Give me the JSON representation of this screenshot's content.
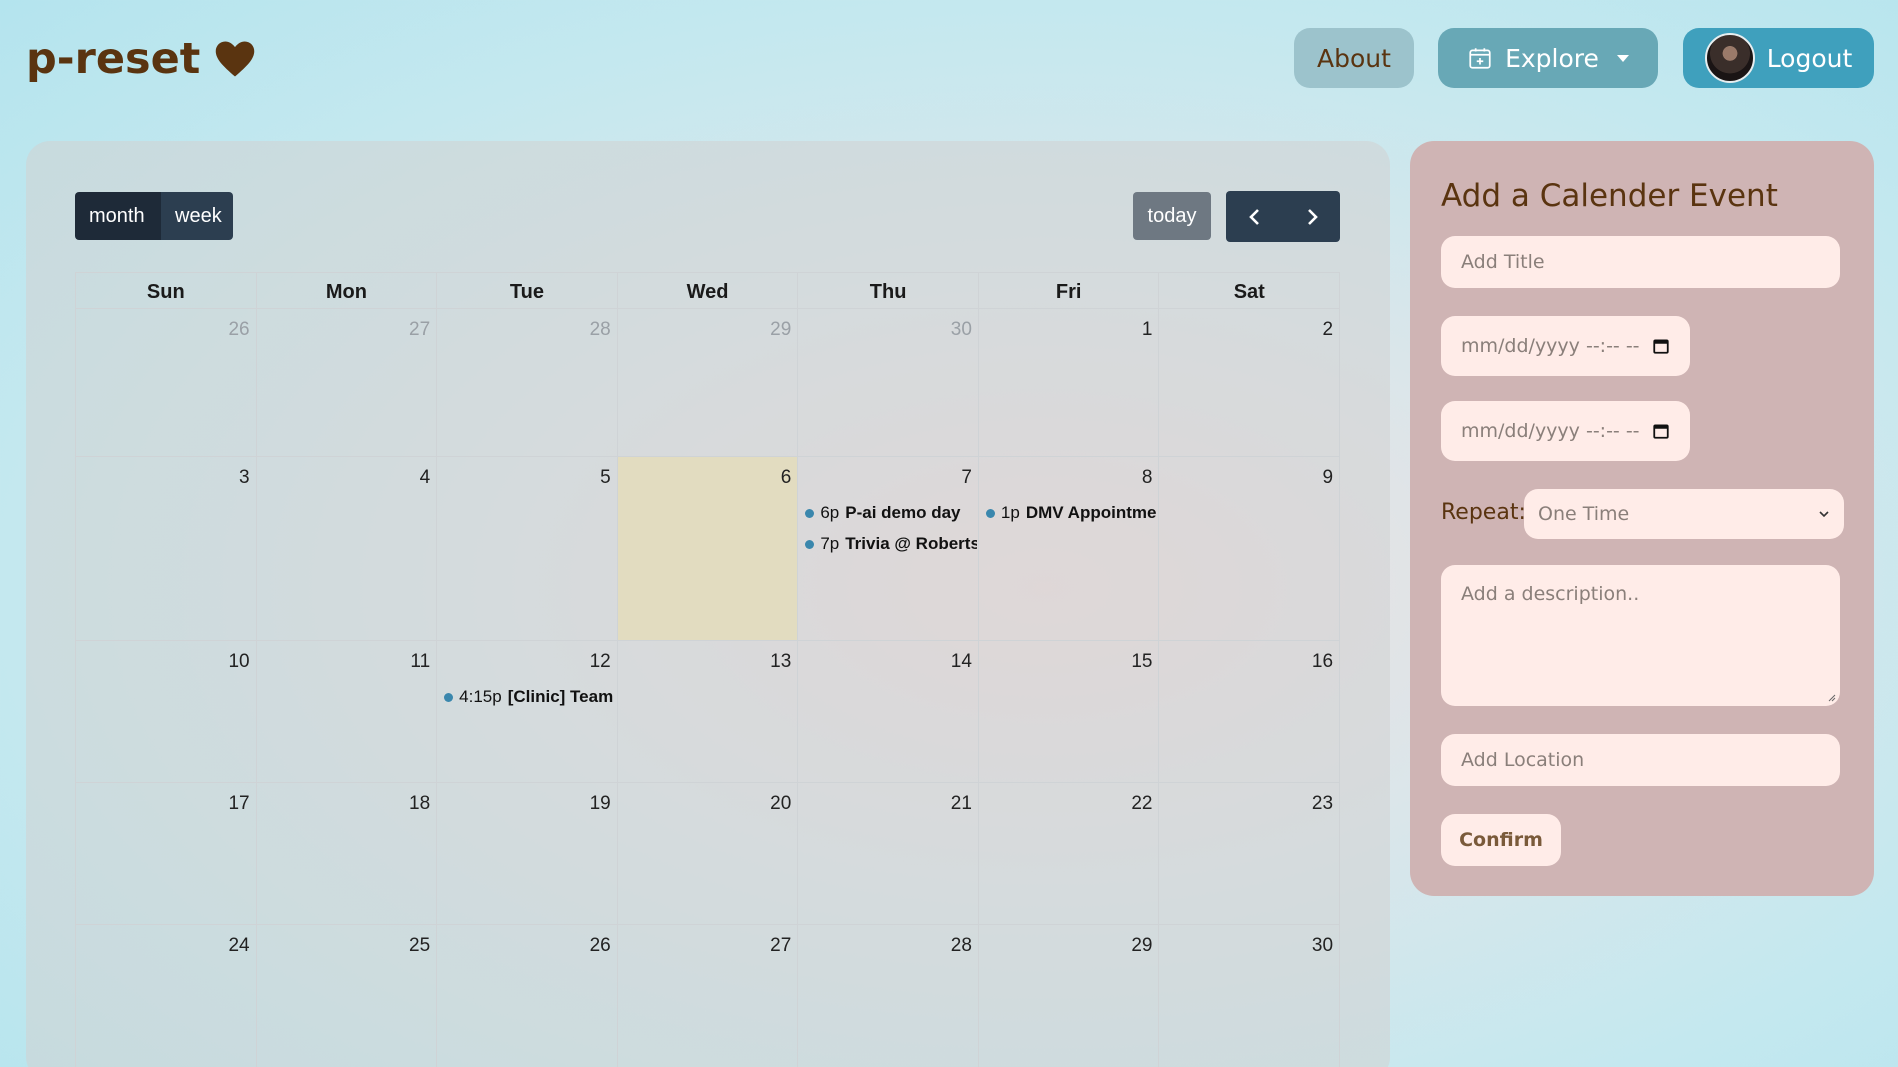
{
  "brand": {
    "name": "p-reset",
    "icon": "heart-icon",
    "color": "#5a3410"
  },
  "nav": {
    "about": "About",
    "explore": "Explore",
    "logout": "Logout"
  },
  "calendar": {
    "views": [
      "month",
      "week"
    ],
    "active_view": "month",
    "today_label": "today",
    "day_headers": [
      "Sun",
      "Mon",
      "Tue",
      "Wed",
      "Thu",
      "Fri",
      "Sat"
    ],
    "weeks": [
      [
        {
          "d": "26",
          "other": true
        },
        {
          "d": "27",
          "other": true
        },
        {
          "d": "28",
          "other": true
        },
        {
          "d": "29",
          "other": true
        },
        {
          "d": "30",
          "other": true
        },
        {
          "d": "1"
        },
        {
          "d": "2"
        }
      ],
      [
        {
          "d": "3"
        },
        {
          "d": "4"
        },
        {
          "d": "5"
        },
        {
          "d": "6",
          "today": true
        },
        {
          "d": "7"
        },
        {
          "d": "8"
        },
        {
          "d": "9"
        }
      ],
      [
        {
          "d": "10"
        },
        {
          "d": "11"
        },
        {
          "d": "12"
        },
        {
          "d": "13"
        },
        {
          "d": "14"
        },
        {
          "d": "15"
        },
        {
          "d": "16"
        }
      ],
      [
        {
          "d": "17"
        },
        {
          "d": "18"
        },
        {
          "d": "19"
        },
        {
          "d": "20"
        },
        {
          "d": "21"
        },
        {
          "d": "22"
        },
        {
          "d": "23"
        }
      ],
      [
        {
          "d": "24"
        },
        {
          "d": "25"
        },
        {
          "d": "26"
        },
        {
          "d": "27"
        },
        {
          "d": "28"
        },
        {
          "d": "29"
        },
        {
          "d": "30"
        }
      ]
    ],
    "events": [
      {
        "week": 1,
        "day": 4,
        "slot": 0,
        "time": "6p",
        "title": "P-ai demo day"
      },
      {
        "week": 1,
        "day": 4,
        "slot": 1,
        "time": "7p",
        "title": "Trivia @ Roberts"
      },
      {
        "week": 1,
        "day": 5,
        "slot": 0,
        "time": "1p",
        "title": "DMV Appointme"
      },
      {
        "week": 2,
        "day": 2,
        "slot": 0,
        "time": "4:15p",
        "title": "[Clinic] Team"
      }
    ],
    "event_dot_color": "#3a87ad",
    "today_color": "#e2dcc0"
  },
  "form": {
    "title": "Add a Calender Event",
    "title_placeholder": "Add Title",
    "start_placeholder": "mm/dd/yyyy --:-- --",
    "end_placeholder": "mm/dd/yyyy --:-- --",
    "repeat_label": "Repeat:",
    "repeat_value": "One Time",
    "description_placeholder": "Add a description..",
    "location_placeholder": "Add Location",
    "confirm_label": "Confirm"
  }
}
